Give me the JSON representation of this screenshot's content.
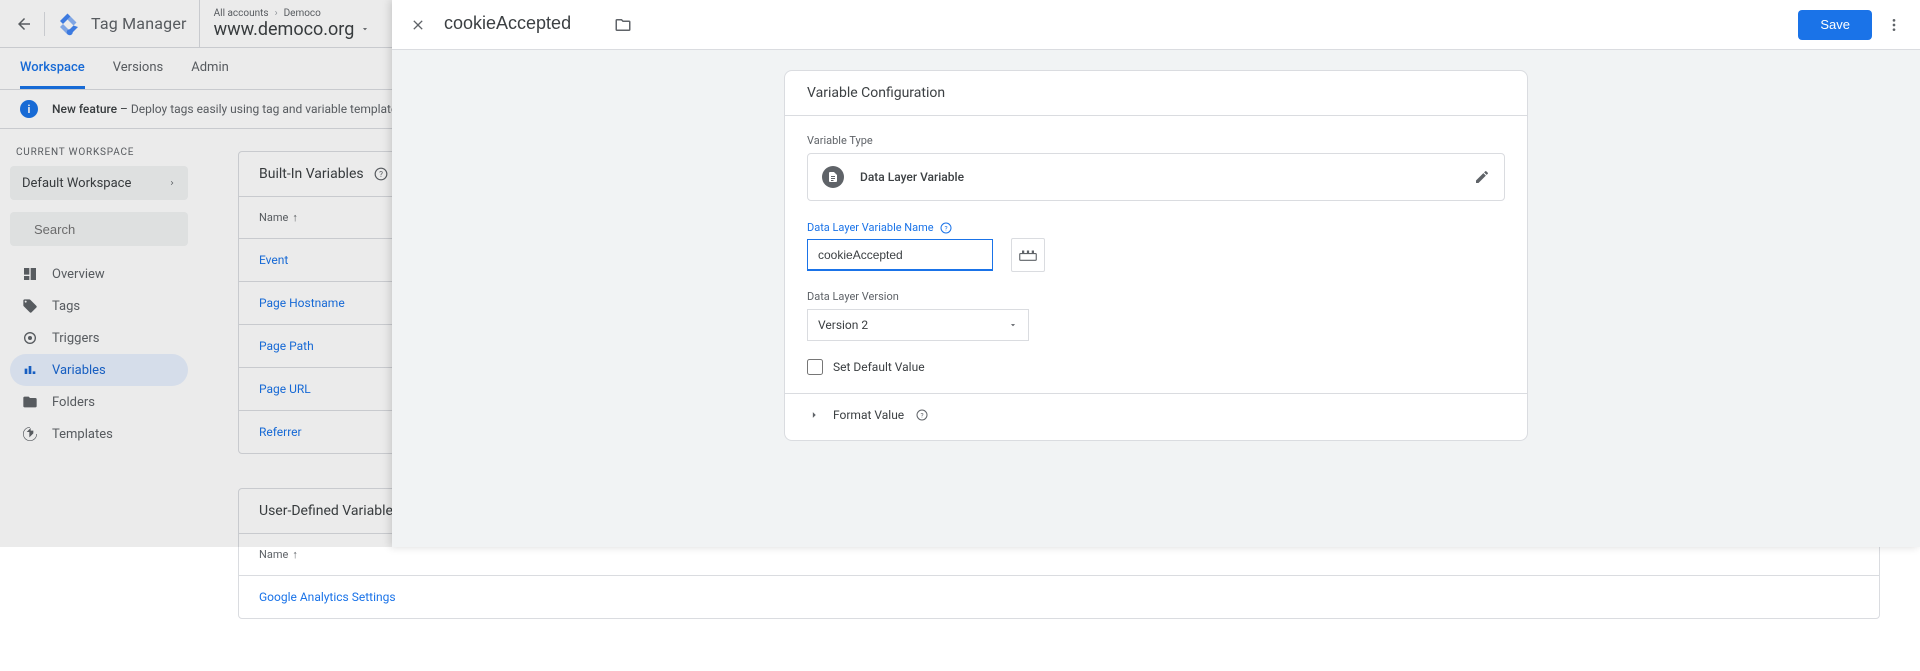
{
  "header": {
    "productName": "Tag Manager",
    "breadcrumb": {
      "all": "All accounts",
      "account": "Democo"
    },
    "container": "www.democo.org"
  },
  "tabs": {
    "workspace": "Workspace",
    "versions": "Versions",
    "admin": "Admin"
  },
  "banner": {
    "newFeature": "New feature",
    "text": "Deploy tags easily using tag and variable templates fr"
  },
  "sidebar": {
    "wsHdr": "CURRENT WORKSPACE",
    "workspace": "Default Workspace",
    "searchPlaceholder": "Search",
    "items": {
      "overview": "Overview",
      "tags": "Tags",
      "triggers": "Triggers",
      "variables": "Variables",
      "folders": "Folders",
      "templates": "Templates"
    }
  },
  "builtInPanel": {
    "title": "Built-In Variables",
    "nameHdr": "Name",
    "rows": [
      "Event",
      "Page Hostname",
      "Page Path",
      "Page URL",
      "Referrer"
    ]
  },
  "userPanel": {
    "title": "User-Defined Variables",
    "nameHdr": "Name",
    "rows": [
      "Google Analytics Settings"
    ]
  },
  "modal": {
    "title": "cookieAccepted",
    "save": "Save",
    "cardTitle": "Variable Configuration",
    "typeLabel": "Variable Type",
    "typeName": "Data Layer Variable",
    "dlvNameLabel": "Data Layer Variable Name",
    "dlvNameValue": "cookieAccepted",
    "dlVersionLabel": "Data Layer Version",
    "dlVersionValue": "Version 2",
    "setDefault": "Set Default Value",
    "formatValue": "Format Value"
  }
}
